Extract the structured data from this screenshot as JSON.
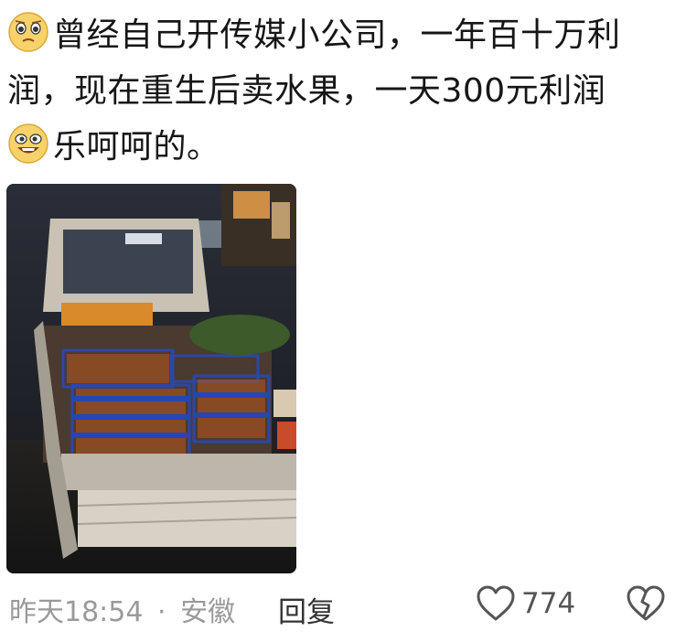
{
  "post": {
    "line1": "曾经自己开传媒小公司，一年百十万利",
    "line2": "润，现在重生后卖水果，一天300元利润",
    "line3": "乐呵呵的。",
    "emoji1": "pleading-face-emoji",
    "emoji2": "grinning-face-emoji"
  },
  "photo": {
    "description_icon": "fruit-truck-photo"
  },
  "footer": {
    "timestamp": "昨天18:54",
    "separator": "·",
    "location": "安徽",
    "reply_label": "回复",
    "like_count": "774"
  }
}
